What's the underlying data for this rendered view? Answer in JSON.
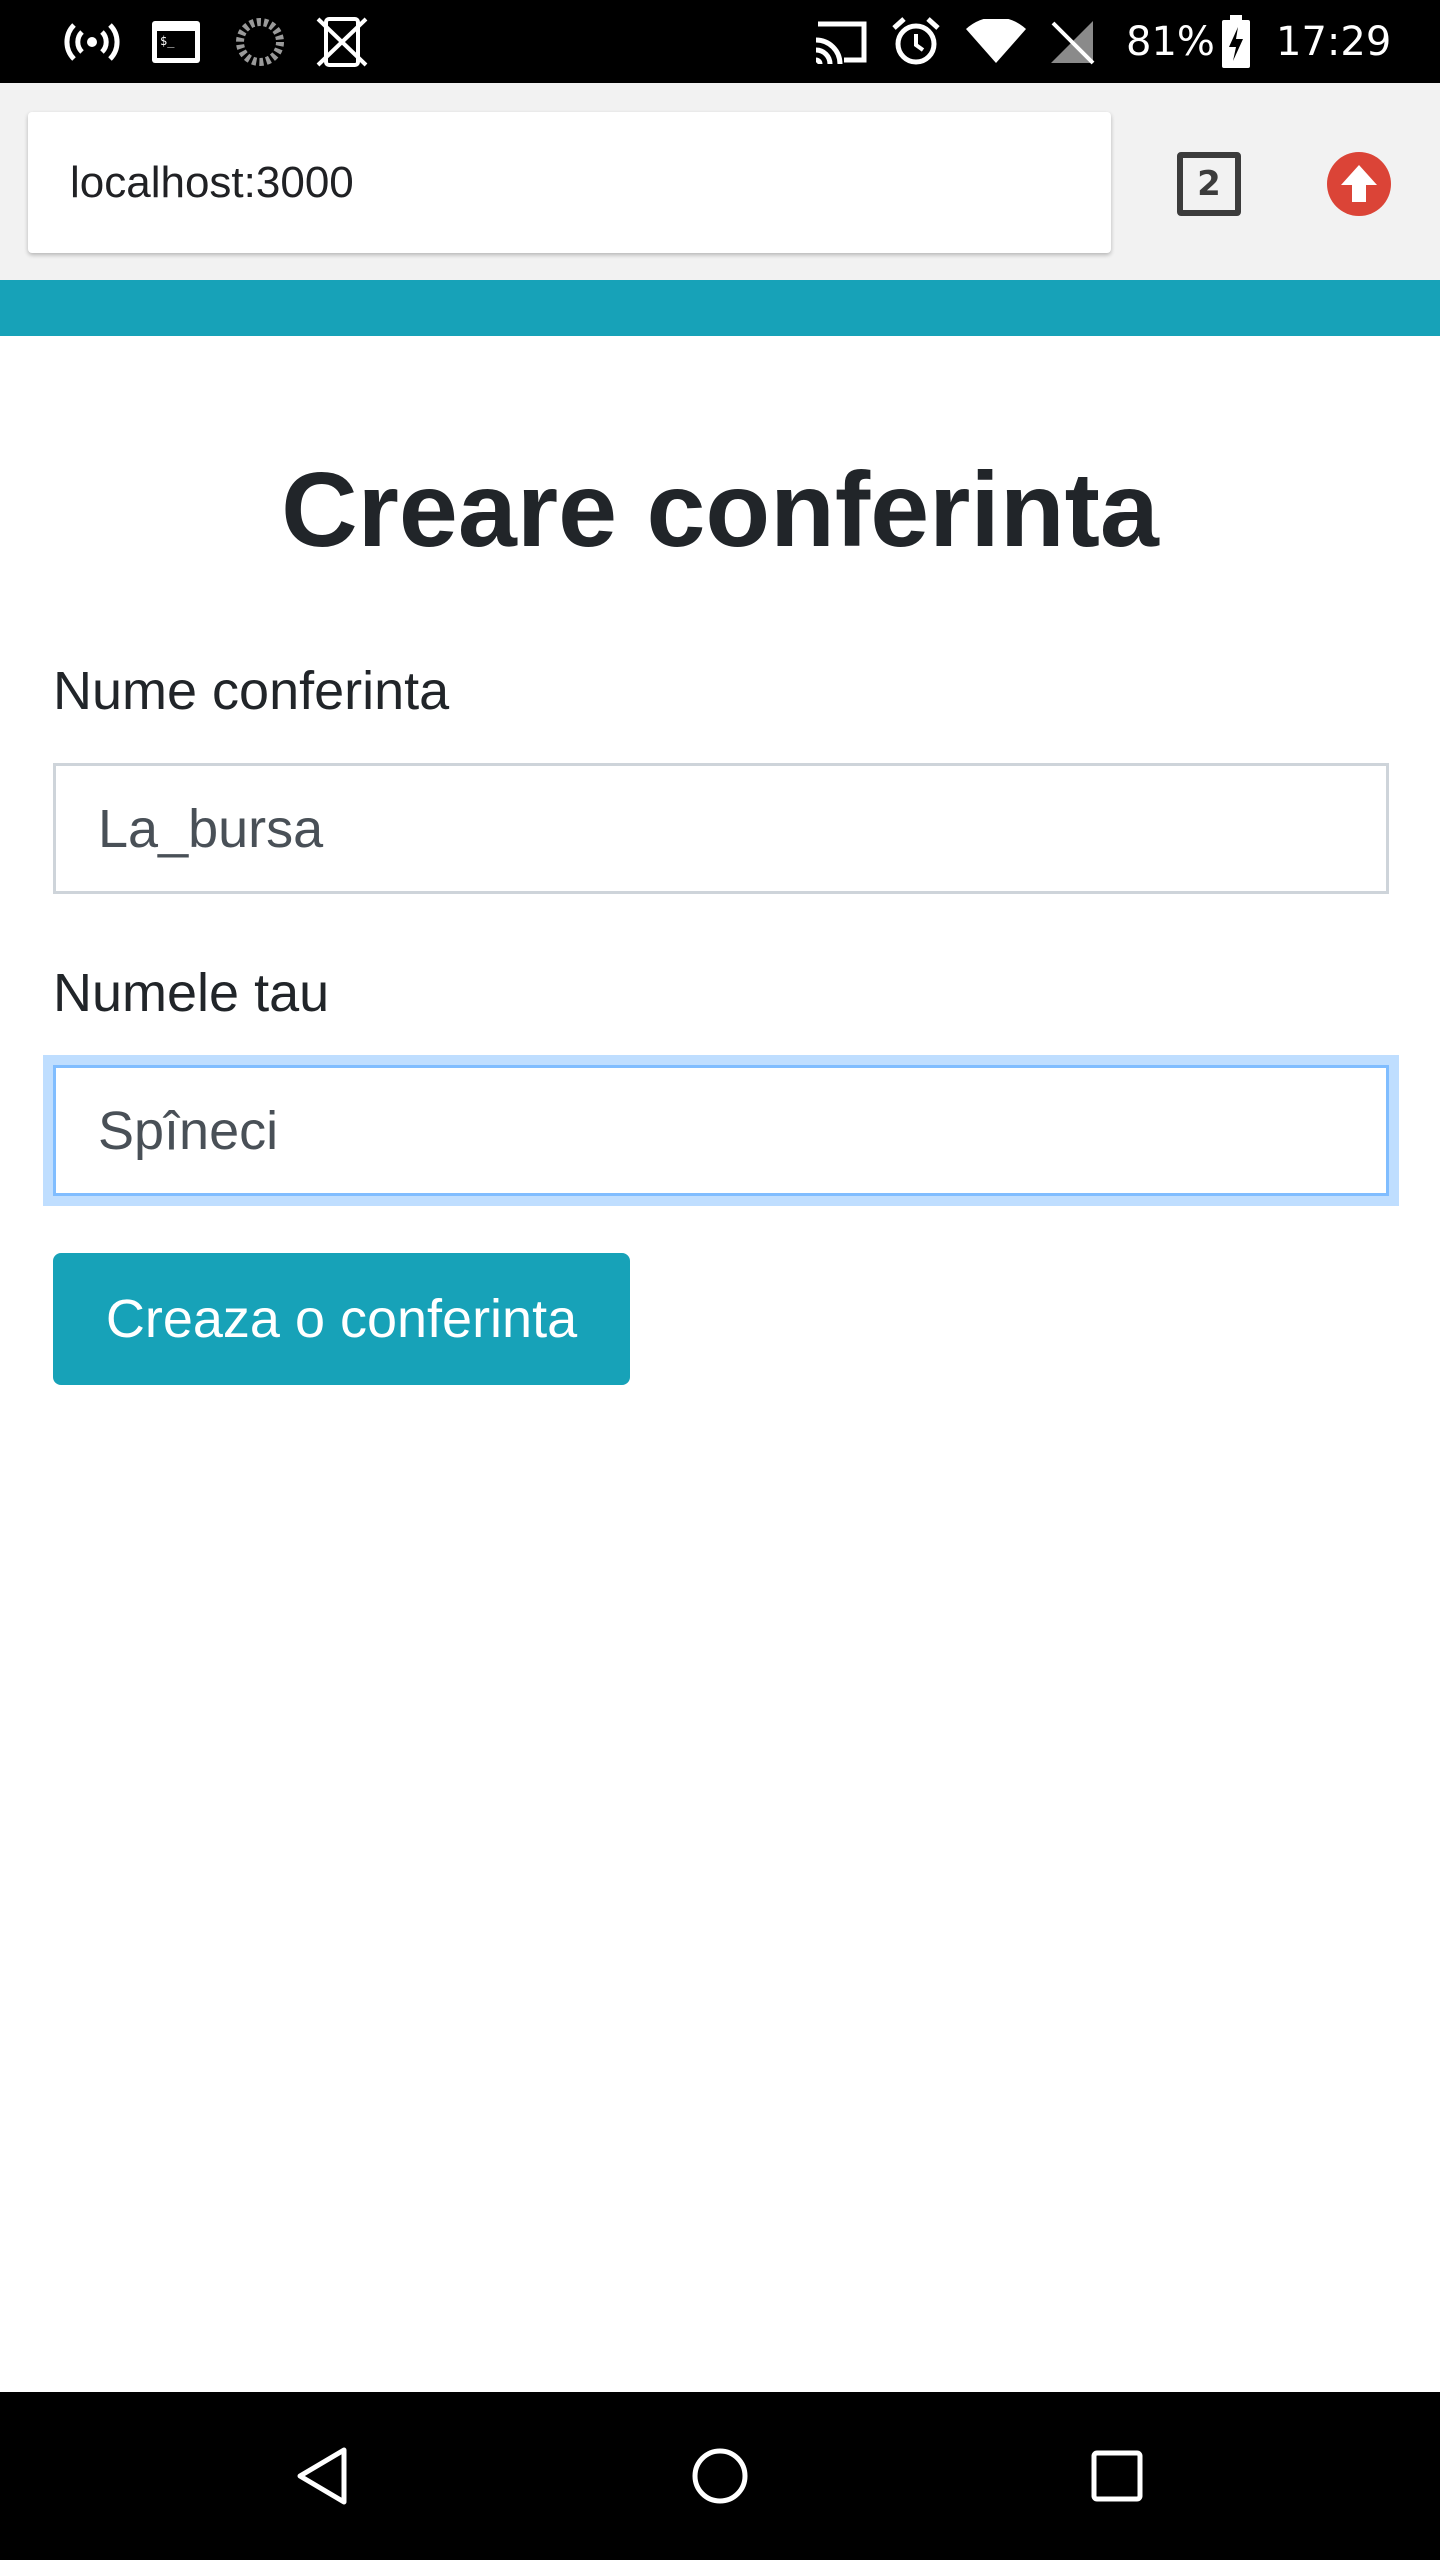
{
  "status_bar": {
    "battery": "81%",
    "time": "17:29",
    "icons": [
      "hotspot-icon",
      "terminal-icon",
      "loading-icon",
      "no-sim-vibrate-icon",
      "cast-icon",
      "alarm-icon",
      "wifi-icon",
      "no-signal-icon",
      "battery-charging-icon"
    ]
  },
  "browser": {
    "url": "localhost:3000",
    "tab_count": "2",
    "update_icon": "update-arrow-icon"
  },
  "colors": {
    "accent": "#17a2b8",
    "update_red": "#db4437",
    "focus_blue": "#80bdff"
  },
  "form": {
    "title": "Creare conferinta",
    "conference_name_label": "Nume conferinta",
    "conference_name_value": "La_bursa",
    "your_name_label": "Numele tau",
    "your_name_value": "Spîneci",
    "submit_label": "Creaza o conferinta"
  },
  "nav": {
    "back_icon": "back-triangle-icon",
    "home_icon": "home-circle-icon",
    "recents_icon": "recents-square-icon"
  }
}
